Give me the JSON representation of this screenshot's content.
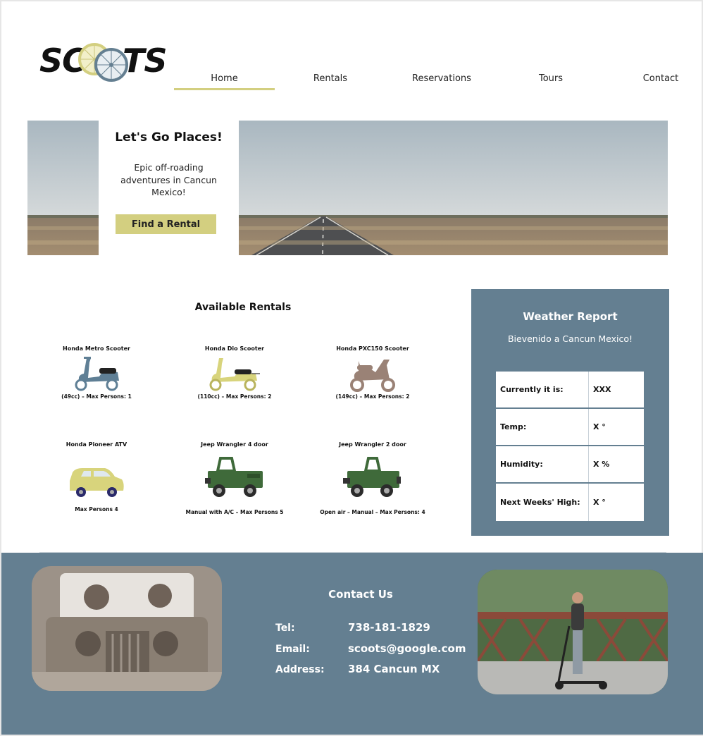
{
  "brand": {
    "logo_left": "SC",
    "logo_right": "TS",
    "accent_color": "#d3cf80",
    "panel_color": "#647f91"
  },
  "nav": {
    "items": [
      "Home",
      "Rentals",
      "Reservations",
      "Tours",
      "Contact"
    ],
    "active": "Home"
  },
  "hero": {
    "title": "Let's Go Places!",
    "subtitle": "Epic off-roading adventures in Cancun Mexico!",
    "button": "Find a Rental"
  },
  "rentals": {
    "title": "Available Rentals",
    "items": [
      {
        "name": "Honda Metro Scooter",
        "detail": "(49cc) – Max Persons: 1",
        "icon": "scooter-icon",
        "color": "#5f7f95"
      },
      {
        "name": "Honda Dio Scooter",
        "detail": "(110cc) – Max Persons: 2",
        "icon": "scooter-icon",
        "color": "#d8d47c"
      },
      {
        "name": "Honda PXC150 Scooter",
        "detail": "(149cc) – Max Persons: 2",
        "icon": "scooter-icon",
        "color": "#9a8276"
      },
      {
        "name": "Honda Pioneer ATV",
        "detail": "Max Persons 4",
        "icon": "car-icon",
        "color": "#d8d47c"
      },
      {
        "name": "Jeep Wrangler 4 door",
        "detail": "Manual with A/C – Max Persons 5",
        "icon": "jeep-icon",
        "color": "#3f6a3a"
      },
      {
        "name": "Jeep Wrangler 2 door",
        "detail": "Open air – Manual – Max Persons: 4",
        "icon": "jeep-icon",
        "color": "#3f6a3a"
      }
    ]
  },
  "weather": {
    "title": "Weather Report",
    "greeting": "Bievenido a Cancun Mexico!",
    "rows": [
      {
        "label": "Currently it is:",
        "value": "XXX"
      },
      {
        "label": "Temp:",
        "value": "X °"
      },
      {
        "label": "Humidity:",
        "value": "X %"
      },
      {
        "label": "Next Weeks' High:",
        "value": "X °"
      }
    ]
  },
  "contact": {
    "title": "Contact Us",
    "rows": [
      {
        "label": "Tel:",
        "value": "738-181-1829"
      },
      {
        "label": "Email:",
        "value": "scoots@google.com"
      },
      {
        "label": "Address:",
        "value": "384 Cancun MX"
      }
    ]
  }
}
